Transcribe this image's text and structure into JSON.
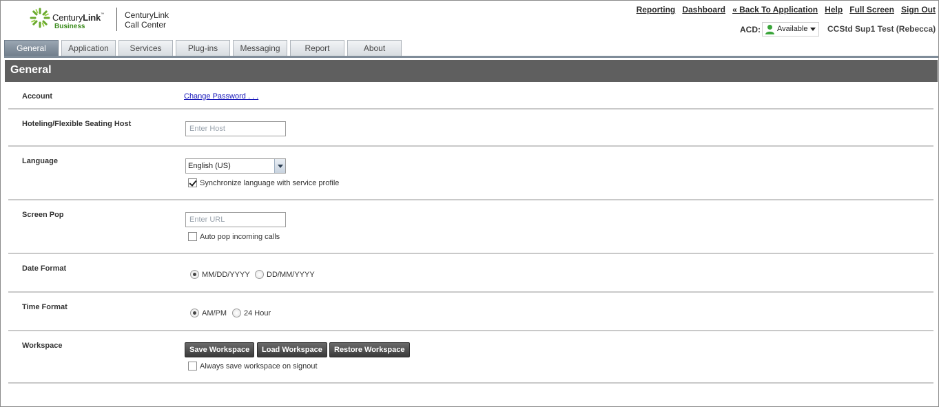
{
  "brand": {
    "logo_text_light": "Century",
    "logo_text_bold": "Link",
    "logo_tm": "™",
    "logo_sub": "Business",
    "app_line1": "CenturyLink",
    "app_line2": "Call Center",
    "logo_color": "#3c8c1e"
  },
  "toplinks": [
    "Reporting",
    "Dashboard",
    "« Back To Application",
    "Help",
    "Full Screen",
    "Sign Out"
  ],
  "acd": {
    "label": "ACD:",
    "status": "Available",
    "status_icon": "person-icon"
  },
  "user": {
    "name": "CCStd Sup1 Test (Rebecca)"
  },
  "tabs": [
    "General",
    "Application",
    "Services",
    "Plug-ins",
    "Messaging",
    "Report",
    "About"
  ],
  "active_tab": "General",
  "section": {
    "title": "General"
  },
  "rows": {
    "account": {
      "label": "Account",
      "link": "Change Password . . ."
    },
    "hoteling": {
      "label": "Hoteling/Flexible Seating Host",
      "placeholder": "Enter Host",
      "value": ""
    },
    "language": {
      "label": "Language",
      "selected": "English (US)",
      "sync_label": "Synchronize language with service profile",
      "sync_checked": true
    },
    "screenpop": {
      "label": "Screen Pop",
      "placeholder": "Enter URL",
      "value": "",
      "auto_label": "Auto pop incoming calls",
      "auto_checked": false
    },
    "dateformat": {
      "label": "Date Format",
      "opt1": "MM/DD/YYYY",
      "opt2": "DD/MM/YYYY",
      "selected": "MM/DD/YYYY"
    },
    "timeformat": {
      "label": "Time Format",
      "opt1": "AM/PM",
      "opt2": "24 Hour",
      "selected": "AM/PM"
    },
    "workspace": {
      "label": "Workspace",
      "save": "Save Workspace",
      "load": "Load Workspace",
      "restore": "Restore Workspace",
      "always_label": "Always save workspace on signout",
      "always_checked": false
    }
  },
  "colors": {
    "section_header_bg": "#5f5f5f",
    "active_tab_bg": "#7f8c99",
    "link": "#1414b8"
  }
}
